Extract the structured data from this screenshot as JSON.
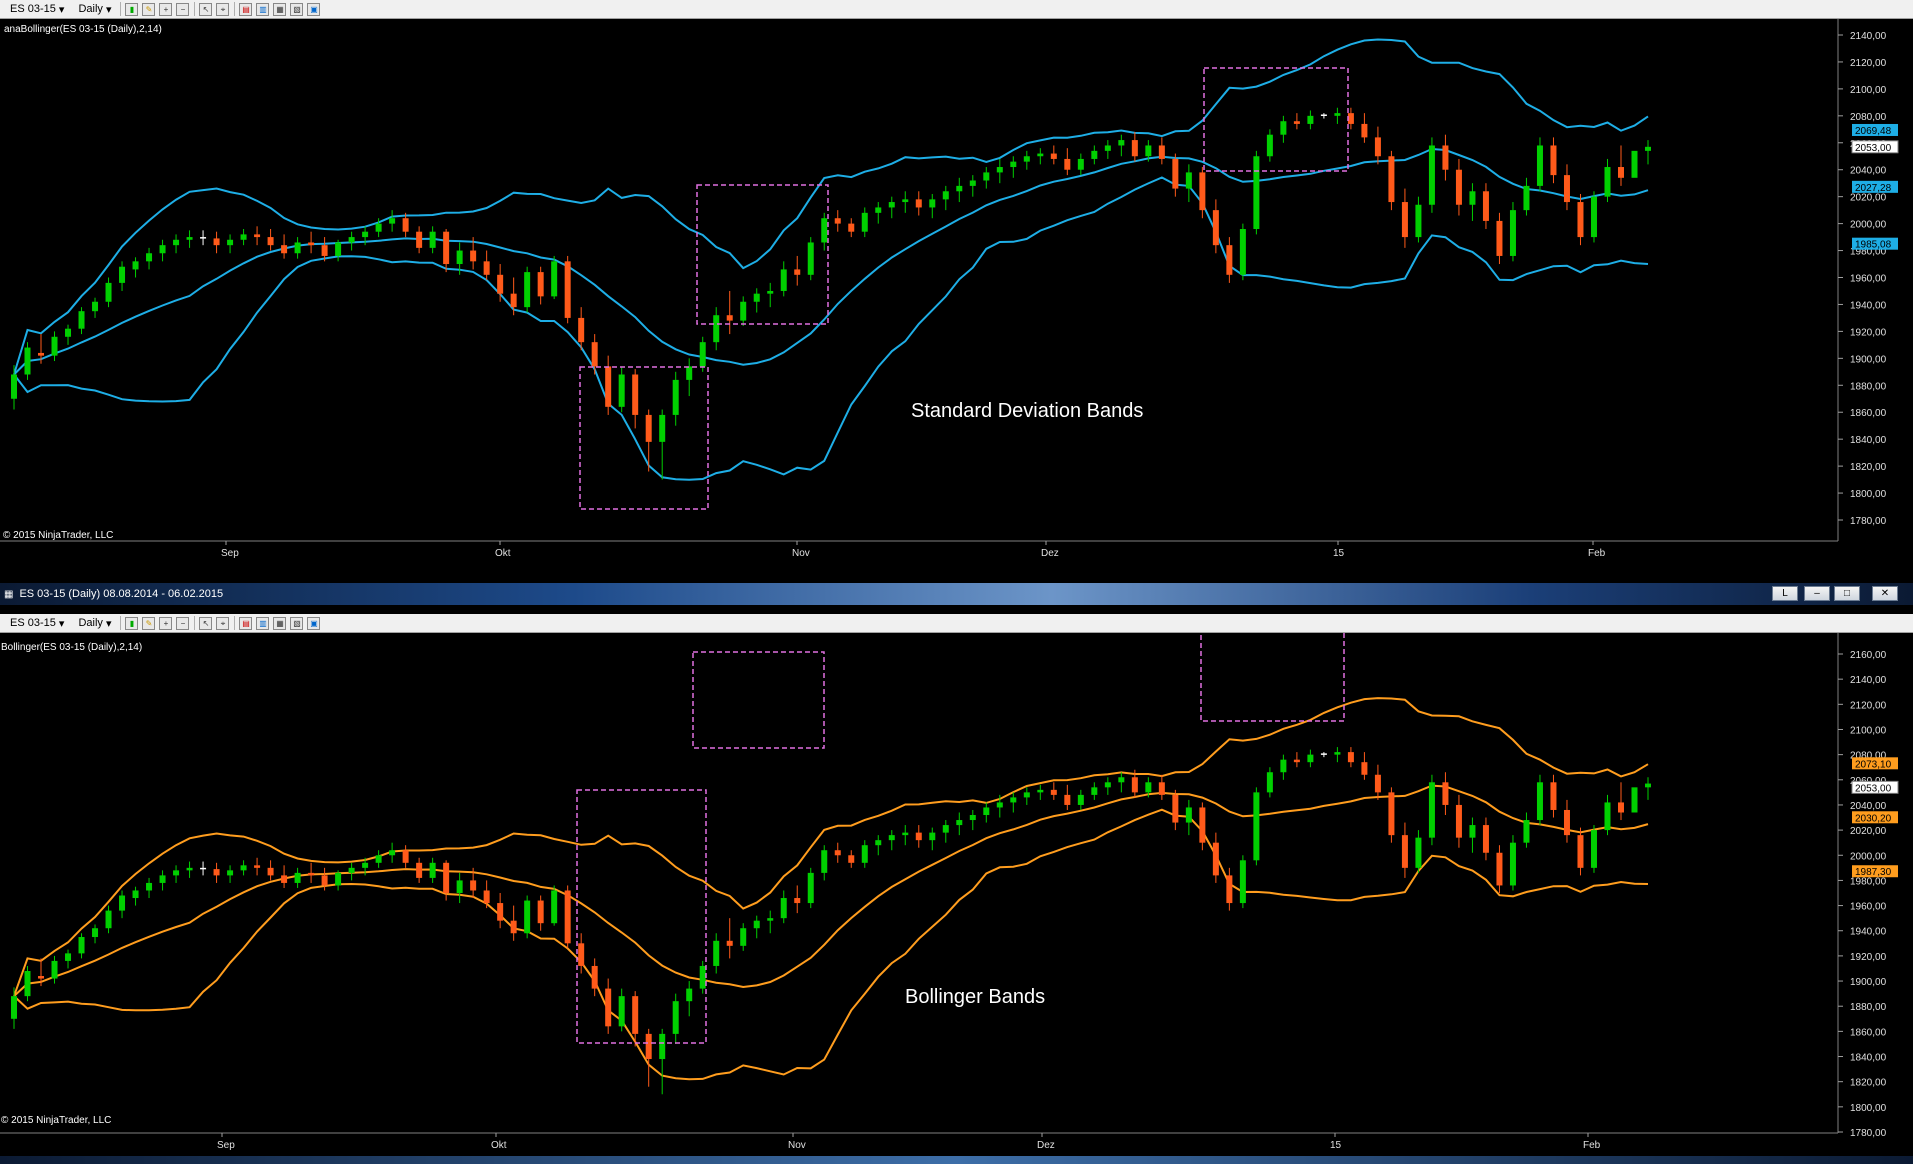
{
  "colors": {
    "background": "#000000",
    "up_candle": "#00d000",
    "down_candle": "#ff5a1a",
    "doji_candle": "#ffffff",
    "sd_bands": "#1eaee6",
    "bollinger_bands": "#ff9d1e",
    "highlight_box": "#e070e0",
    "axis_text": "#c8c8c8"
  },
  "toolbar": {
    "instrument": "ES 03-15",
    "period": "Daily",
    "icons": [
      "bar-chart-icon",
      "draw-pencil-icon",
      "zoom-in-icon",
      "zoom-out-icon",
      "pointer-icon",
      "crosshair-icon",
      "indicators-icon",
      "strategies-icon",
      "templates-icon",
      "properties-icon",
      "data-box-icon"
    ]
  },
  "top_chart": {
    "indicator_label": "anaBollinger(ES 03-15 (Daily),2,14)",
    "annotation": "Standard Deviation Bands",
    "copyright": "© 2015 NinjaTrader, LLC",
    "price_labels": [
      "2140,00",
      "2120,00",
      "2100,00",
      "2080,00",
      "2060,00",
      "2040,00",
      "2020,00",
      "2000,00",
      "1980,00",
      "1960,00",
      "1940,00",
      "1920,00",
      "1900,00",
      "1880,00",
      "1860,00",
      "1840,00",
      "1820,00",
      "1800,00",
      "1780,00"
    ],
    "badges": [
      {
        "text": "2069,48",
        "price": 2069.5,
        "type": "band"
      },
      {
        "text": "2053,00",
        "price": 2057,
        "type": "price"
      },
      {
        "text": "2027,28",
        "price": 2027.3,
        "type": "band"
      },
      {
        "text": "1985,08",
        "price": 1985.1,
        "type": "band"
      }
    ],
    "date_labels": [
      "Sep",
      "Okt",
      "Nov",
      "Dez",
      "15",
      "Feb"
    ]
  },
  "window": {
    "title": "ES 03-15 (Daily)  08.08.2014 - 06.02.2015",
    "buttons": [
      "L",
      "–",
      "□",
      "✕"
    ]
  },
  "bottom_chart": {
    "indicator_label": "Bollinger(ES 03-15 (Daily),2,14)",
    "annotation": "Bollinger Bands",
    "copyright": "© 2015 NinjaTrader, LLC",
    "price_labels": [
      "2160,00",
      "2140,00",
      "2120,00",
      "2100,00",
      "2080,00",
      "2060,00",
      "2040,00",
      "2020,00",
      "2000,00",
      "1980,00",
      "1960,00",
      "1940,00",
      "1920,00",
      "1900,00",
      "1880,00",
      "1860,00",
      "1840,00",
      "1820,00",
      "1800,00",
      "1780,00"
    ],
    "badges": [
      {
        "text": "2073,10",
        "price": 2073.1,
        "type": "band"
      },
      {
        "text": "2053,00",
        "price": 2054,
        "type": "price"
      },
      {
        "text": "2030,20",
        "price": 2030.2,
        "type": "band"
      },
      {
        "text": "1987,30",
        "price": 1987.3,
        "type": "band"
      }
    ],
    "date_labels": [
      "Sep",
      "Okt",
      "Nov",
      "Dez",
      "15",
      "Feb"
    ]
  },
  "chart_data": {
    "type": "candlestick",
    "instrument": "ES 03-15",
    "period": "Daily",
    "date_range": "08.08.2014 - 06.02.2015",
    "ohlc": [
      [
        1870,
        1895,
        1862,
        1888
      ],
      [
        1888,
        1912,
        1884,
        1908
      ],
      [
        1904,
        1918,
        1896,
        1902
      ],
      [
        1902,
        1920,
        1898,
        1916
      ],
      [
        1916,
        1925,
        1910,
        1922
      ],
      [
        1922,
        1938,
        1918,
        1935
      ],
      [
        1935,
        1945,
        1930,
        1942
      ],
      [
        1942,
        1960,
        1938,
        1956
      ],
      [
        1956,
        1972,
        1950,
        1968
      ],
      [
        1966,
        1975,
        1960,
        1972
      ],
      [
        1972,
        1982,
        1966,
        1978
      ],
      [
        1978,
        1988,
        1972,
        1984
      ],
      [
        1984,
        1992,
        1978,
        1988
      ],
      [
        1988,
        1995,
        1982,
        1990
      ],
      [
        1990,
        1995,
        1984,
        1989
      ],
      [
        1989,
        1994,
        1978,
        1984
      ],
      [
        1984,
        1992,
        1978,
        1988
      ],
      [
        1988,
        1996,
        1984,
        1992
      ],
      [
        1992,
        1998,
        1984,
        1990
      ],
      [
        1990,
        1996,
        1980,
        1984
      ],
      [
        1984,
        1992,
        1974,
        1978
      ],
      [
        1978,
        1990,
        1974,
        1986
      ],
      [
        1986,
        1994,
        1978,
        1984
      ],
      [
        1984,
        1990,
        1972,
        1976
      ],
      [
        1976,
        1988,
        1972,
        1986
      ],
      [
        1986,
        1994,
        1980,
        1990
      ],
      [
        1990,
        1998,
        1984,
        1994
      ],
      [
        1994,
        2004,
        1990,
        2000
      ],
      [
        2000,
        2010,
        1994,
        2004
      ],
      [
        2004,
        2008,
        1990,
        1994
      ],
      [
        1994,
        1998,
        1978,
        1982
      ],
      [
        1982,
        1998,
        1978,
        1994
      ],
      [
        1994,
        1996,
        1964,
        1970
      ],
      [
        1970,
        1986,
        1962,
        1980
      ],
      [
        1980,
        1990,
        1966,
        1972
      ],
      [
        1972,
        1980,
        1958,
        1962
      ],
      [
        1962,
        1970,
        1942,
        1948
      ],
      [
        1948,
        1960,
        1932,
        1938
      ],
      [
        1938,
        1968,
        1934,
        1964
      ],
      [
        1964,
        1968,
        1940,
        1946
      ],
      [
        1946,
        1976,
        1944,
        1972
      ],
      [
        1972,
        1976,
        1926,
        1930
      ],
      [
        1930,
        1938,
        1906,
        1912
      ],
      [
        1912,
        1918,
        1888,
        1894
      ],
      [
        1894,
        1902,
        1858,
        1864
      ],
      [
        1864,
        1894,
        1860,
        1888
      ],
      [
        1888,
        1892,
        1848,
        1858
      ],
      [
        1858,
        1862,
        1816,
        1838
      ],
      [
        1838,
        1862,
        1810,
        1858
      ],
      [
        1858,
        1890,
        1850,
        1884
      ],
      [
        1884,
        1900,
        1872,
        1894
      ],
      [
        1894,
        1916,
        1890,
        1912
      ],
      [
        1912,
        1938,
        1906,
        1932
      ],
      [
        1932,
        1950,
        1918,
        1928
      ],
      [
        1928,
        1946,
        1924,
        1942
      ],
      [
        1942,
        1952,
        1934,
        1948
      ],
      [
        1948,
        1956,
        1938,
        1950
      ],
      [
        1950,
        1972,
        1946,
        1966
      ],
      [
        1966,
        1976,
        1954,
        1962
      ],
      [
        1962,
        1990,
        1958,
        1986
      ],
      [
        1986,
        2008,
        1980,
        2004
      ],
      [
        2004,
        2010,
        1994,
        2000
      ],
      [
        2000,
        2004,
        1990,
        1994
      ],
      [
        1994,
        2012,
        1990,
        2008
      ],
      [
        2008,
        2016,
        2000,
        2012
      ],
      [
        2012,
        2020,
        2004,
        2016
      ],
      [
        2016,
        2024,
        2008,
        2018
      ],
      [
        2018,
        2024,
        2006,
        2012
      ],
      [
        2012,
        2022,
        2004,
        2018
      ],
      [
        2018,
        2028,
        2010,
        2024
      ],
      [
        2024,
        2034,
        2016,
        2028
      ],
      [
        2028,
        2036,
        2020,
        2032
      ],
      [
        2032,
        2042,
        2026,
        2038
      ],
      [
        2038,
        2048,
        2030,
        2042
      ],
      [
        2042,
        2050,
        2034,
        2046
      ],
      [
        2046,
        2054,
        2040,
        2050
      ],
      [
        2050,
        2056,
        2044,
        2052
      ],
      [
        2052,
        2058,
        2044,
        2048
      ],
      [
        2048,
        2056,
        2036,
        2040
      ],
      [
        2040,
        2052,
        2036,
        2048
      ],
      [
        2048,
        2058,
        2044,
        2054
      ],
      [
        2054,
        2062,
        2048,
        2058
      ],
      [
        2058,
        2066,
        2050,
        2062
      ],
      [
        2062,
        2068,
        2046,
        2050
      ],
      [
        2050,
        2062,
        2046,
        2058
      ],
      [
        2058,
        2064,
        2044,
        2048
      ],
      [
        2048,
        2052,
        2020,
        2026
      ],
      [
        2026,
        2044,
        2016,
        2038
      ],
      [
        2038,
        2042,
        2004,
        2010
      ],
      [
        2010,
        2018,
        1978,
        1984
      ],
      [
        1984,
        1990,
        1956,
        1962
      ],
      [
        1962,
        2000,
        1958,
        1996
      ],
      [
        1996,
        2054,
        1992,
        2050
      ],
      [
        2050,
        2070,
        2046,
        2066
      ],
      [
        2066,
        2080,
        2060,
        2076
      ],
      [
        2076,
        2082,
        2070,
        2074
      ],
      [
        2074,
        2084,
        2070,
        2080
      ],
      [
        2080,
        2082,
        2078,
        2081
      ],
      [
        2080,
        2086,
        2074,
        2082
      ],
      [
        2082,
        2086,
        2070,
        2074
      ],
      [
        2074,
        2082,
        2060,
        2064
      ],
      [
        2064,
        2072,
        2044,
        2050
      ],
      [
        2050,
        2054,
        2010,
        2016
      ],
      [
        2016,
        2026,
        1982,
        1990
      ],
      [
        1990,
        2020,
        1986,
        2014
      ],
      [
        2014,
        2064,
        2008,
        2058
      ],
      [
        2058,
        2066,
        2032,
        2040
      ],
      [
        2040,
        2048,
        2006,
        2014
      ],
      [
        2014,
        2030,
        2002,
        2024
      ],
      [
        2024,
        2030,
        1996,
        2002
      ],
      [
        2002,
        2008,
        1970,
        1976
      ],
      [
        1976,
        2016,
        1972,
        2010
      ],
      [
        2010,
        2034,
        2006,
        2028
      ],
      [
        2028,
        2064,
        2024,
        2058
      ],
      [
        2058,
        2064,
        2030,
        2036
      ],
      [
        2036,
        2044,
        2010,
        2016
      ],
      [
        2016,
        2022,
        1984,
        1990
      ],
      [
        1990,
        2024,
        1986,
        2020
      ],
      [
        2020,
        2048,
        2016,
        2042
      ],
      [
        2042,
        2058,
        2028,
        2034
      ],
      [
        2034,
        2040,
        2036,
        2054
      ],
      [
        2054,
        2062,
        2044,
        2057
      ]
    ],
    "std_dev_bands": {
      "upper_last": 2069.48,
      "middle_last": 2027.28,
      "lower_last": 1985.08,
      "period": 14,
      "width": 2
    },
    "bollinger_bands": {
      "upper_last": 2073.1,
      "middle_last": 2030.2,
      "lower_last": 1987.3,
      "period": 14,
      "width": 2
    },
    "last_close": 2053.0,
    "annotations": [
      "Standard Deviation Bands",
      "Bollinger Bands"
    ]
  }
}
